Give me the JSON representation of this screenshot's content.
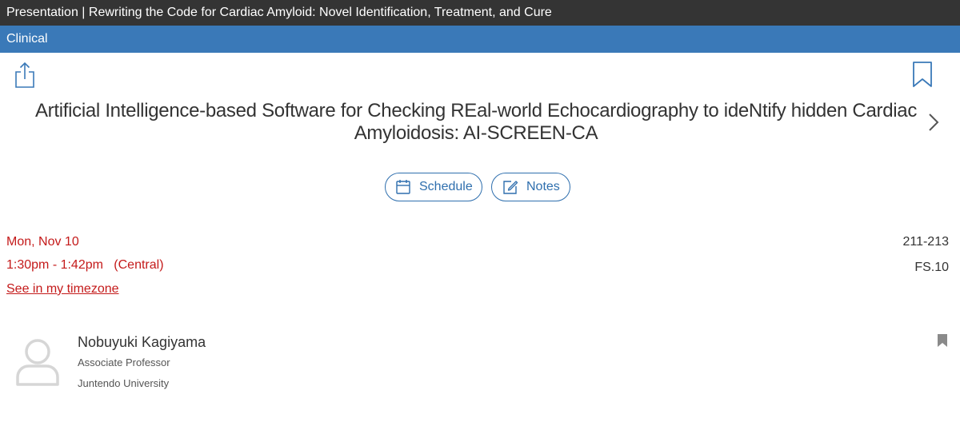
{
  "header": {
    "title": "Presentation | Rewriting the Code for Cardiac Amyloid: Novel Identification, Treatment, and Cure",
    "category": "Clinical"
  },
  "icons": {
    "share": "share-icon",
    "bookmark": "bookmark-icon",
    "next": "chevron-right-icon",
    "calendar": "calendar-icon",
    "notes": "edit-icon",
    "avatar": "user-avatar-icon",
    "speaker_bookmark": "bookmark-filled-icon"
  },
  "presentation": {
    "title": "Artificial Intelligence-based Software for Checking REal-world Echocardiography to ideNtify hidden Cardiac Amyloidosis: AI-SCREEN-CA"
  },
  "actions": {
    "schedule_label": "Schedule",
    "notes_label": "Notes"
  },
  "session": {
    "date": "Mon, Nov 10",
    "time": "1:30pm - 1:42pm   (Central)",
    "timezone_link": "See in my timezone",
    "room": "211-213",
    "code": "FS.10"
  },
  "speaker": {
    "name": "Nobuyuki Kagiyama",
    "title": "Associate Professor",
    "organization": "Juntendo University"
  },
  "colors": {
    "topbar": "#343434",
    "category_bar": "#3a79b8",
    "accent_blue": "#2f6fae",
    "accent_red": "#c41a1a",
    "text": "#333333"
  }
}
